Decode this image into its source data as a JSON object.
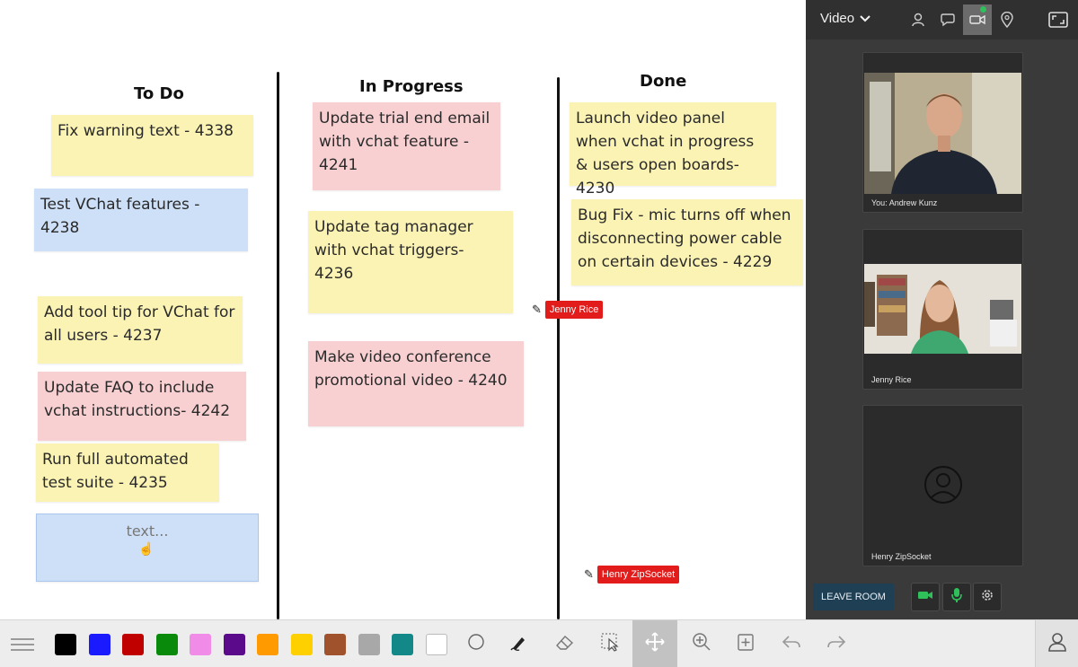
{
  "board": {
    "columns": [
      {
        "title": "To Do"
      },
      {
        "title": "In Progress"
      },
      {
        "title": "Done"
      }
    ],
    "notes": {
      "todo_1": "Fix warning text - 4338",
      "todo_2": "Test VChat features - 4238",
      "todo_3": "Add tool tip for VChat for all users - 4237",
      "todo_4": "Update FAQ to include vchat instructions- 4242",
      "todo_5": "Run full automated test suite - 4235",
      "todo_6_editing": "text...",
      "progress_1": "Update trial end email with vchat feature - 4241",
      "progress_2": "Update tag manager with vchat triggers- 4236",
      "progress_3": "Make video conference promotional video - 4240",
      "done_1": "Launch video panel when vchat in progress & users open boards-4230",
      "done_2": "Bug Fix - mic turns off when disconnecting power cable on certain devices - 4229"
    },
    "cursors": [
      {
        "label": "Jenny Rice"
      },
      {
        "label": "Henry ZipSocket"
      }
    ]
  },
  "video_panel": {
    "dropdown_label": "Video",
    "participants": [
      {
        "name": "You: Andrew Kunz"
      },
      {
        "name": "Jenny Rice"
      },
      {
        "name": "Henry ZipSocket"
      }
    ],
    "leave_label": "LEAVE ROOM"
  },
  "toolbar": {
    "colors": [
      "#000000",
      "#1a1aff",
      "#c00000",
      "#0a8a0a",
      "#f08ce8",
      "#5a0a8a",
      "#ff9a00",
      "#ffd000",
      "#a0522d",
      "#a8a8a8",
      "#138888",
      "#ffffff"
    ]
  },
  "theme": {
    "note_yellow": "#fbf3b4",
    "note_pink": "#f8d0d2",
    "note_blue": "#cde0f8",
    "cursor_tag": "#e21b1b",
    "panel_bg": "#3a3a3a",
    "leave_button": "#1f3f55"
  }
}
